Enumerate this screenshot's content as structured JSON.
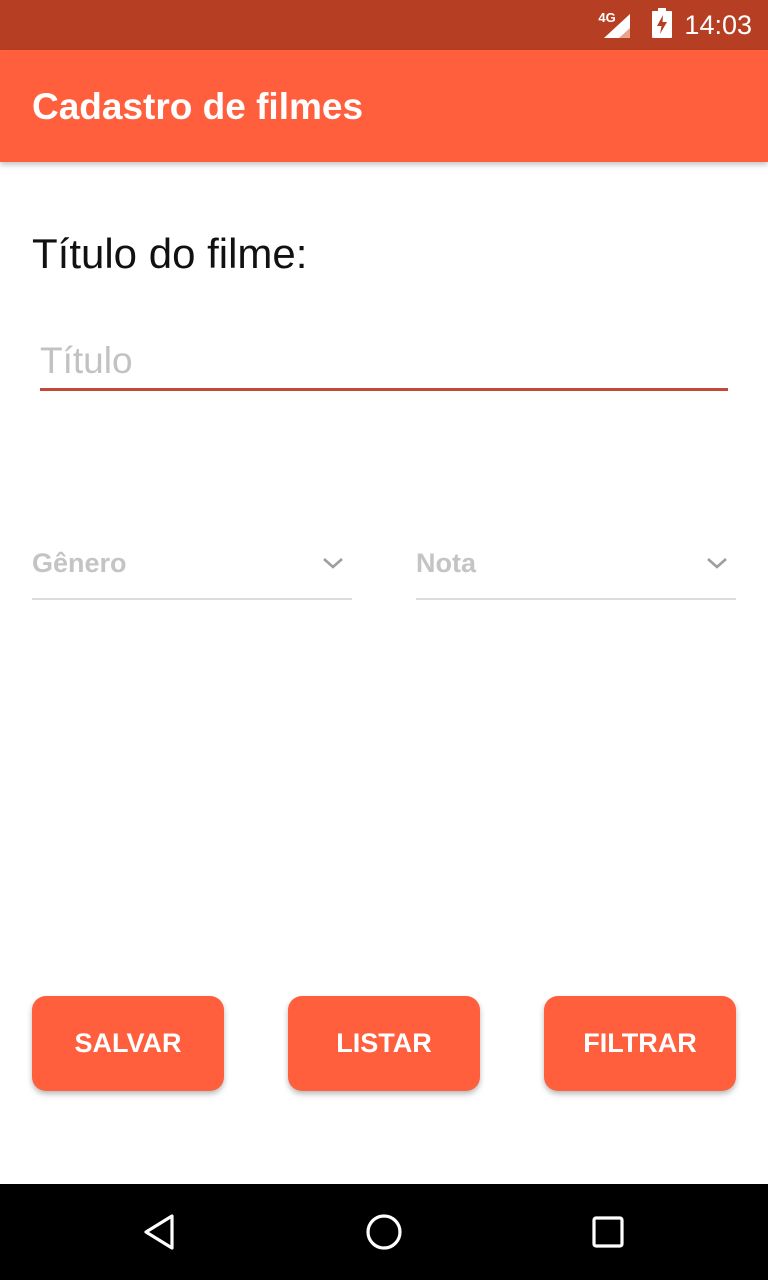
{
  "status_bar": {
    "network": "4G",
    "time": "14:03"
  },
  "app_bar": {
    "title": "Cadastro de filmes"
  },
  "form": {
    "film_label": "Título do filme:",
    "title_input": {
      "placeholder": "Título",
      "value": ""
    },
    "genre_spinner": {
      "text": "Gênero"
    },
    "rating_spinner": {
      "text": "Nota"
    }
  },
  "buttons": {
    "save": "SALVAR",
    "list": "LISTAR",
    "filter": "FILTRAR"
  },
  "colors": {
    "status_bar": "#b63f23",
    "primary": "#ff5f3d",
    "input_underline": "#c0493b",
    "hint": "#c4c4c4"
  },
  "icons": {
    "signal": "signal-icon",
    "battery": "battery-charging-icon",
    "dropdown": "chevron-down-icon",
    "back": "back-triangle-icon",
    "home": "home-circle-icon",
    "recents": "recents-square-icon"
  }
}
